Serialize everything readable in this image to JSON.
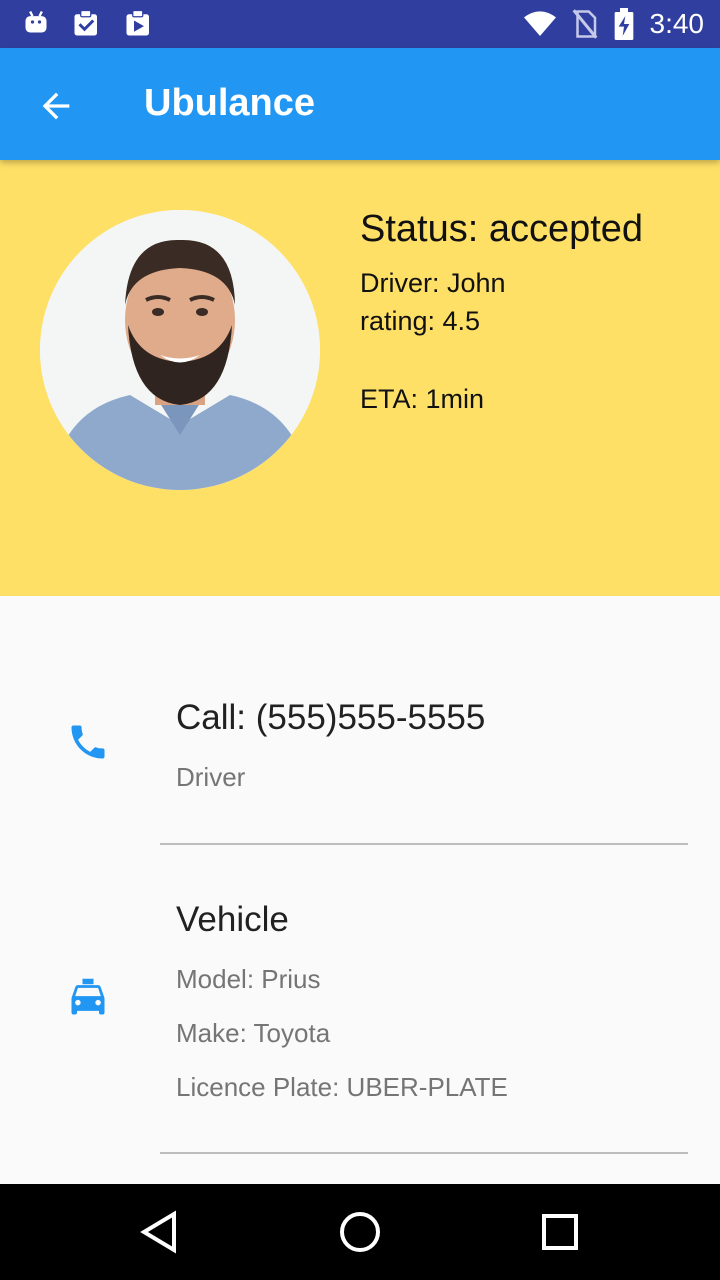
{
  "status_bar": {
    "time": "3:40",
    "left_icons": [
      "android-debug-icon",
      "clipboard-check-icon",
      "play-store-icon"
    ],
    "right_icons": [
      "wifi-icon",
      "no-sim-icon",
      "battery-charging-icon"
    ]
  },
  "app_bar": {
    "title": "Ubulance",
    "back_icon": "arrow-back-icon",
    "color": "#2196f3"
  },
  "driver_card": {
    "status": "Status: accepted",
    "driver": "Driver: John",
    "rating": "rating: 4.5",
    "eta": "ETA: 1min",
    "background": "#ffe066"
  },
  "contact": {
    "icon": "phone-icon",
    "primary": "Call: (555)555-5555",
    "secondary": "Driver"
  },
  "vehicle": {
    "icon": "taxi-icon",
    "title": "Vehicle",
    "model": "Model: Prius",
    "make": "Make: Toyota",
    "plate": "Licence Plate: UBER-PLATE"
  },
  "nav_bar": {
    "buttons": [
      "back-triangle-icon",
      "home-circle-icon",
      "recents-square-icon"
    ]
  },
  "accent_color": "#2196f3"
}
